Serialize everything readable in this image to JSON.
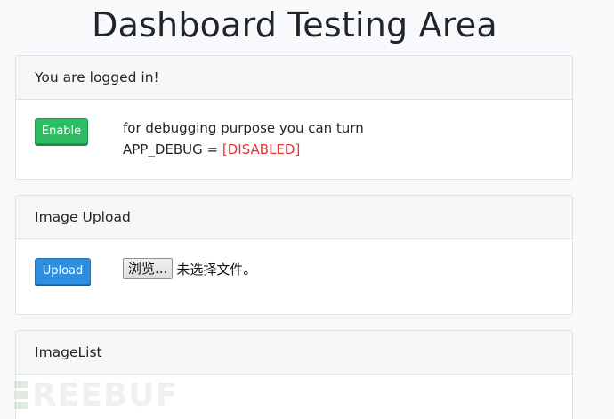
{
  "page": {
    "title": "Dashboard Testing Area"
  },
  "login_card": {
    "header": "You are logged in!",
    "enable_button": "Enable",
    "debug_line1": "for debugging purpose you can turn",
    "debug_prefix": "APP_DEBUG = ",
    "debug_status": "[DISABLED]",
    "debug_status_color": "#e3342f"
  },
  "upload_card": {
    "header": "Image Upload",
    "upload_button": "Upload",
    "file_browse": "浏览...",
    "file_status": "未选择文件。"
  },
  "imagelist_card": {
    "header": "ImageList"
  },
  "watermark": {
    "text": "REEBUF"
  },
  "colors": {
    "success": "#2fbd63",
    "primary": "#2e8ee0",
    "danger": "#e3342f"
  }
}
